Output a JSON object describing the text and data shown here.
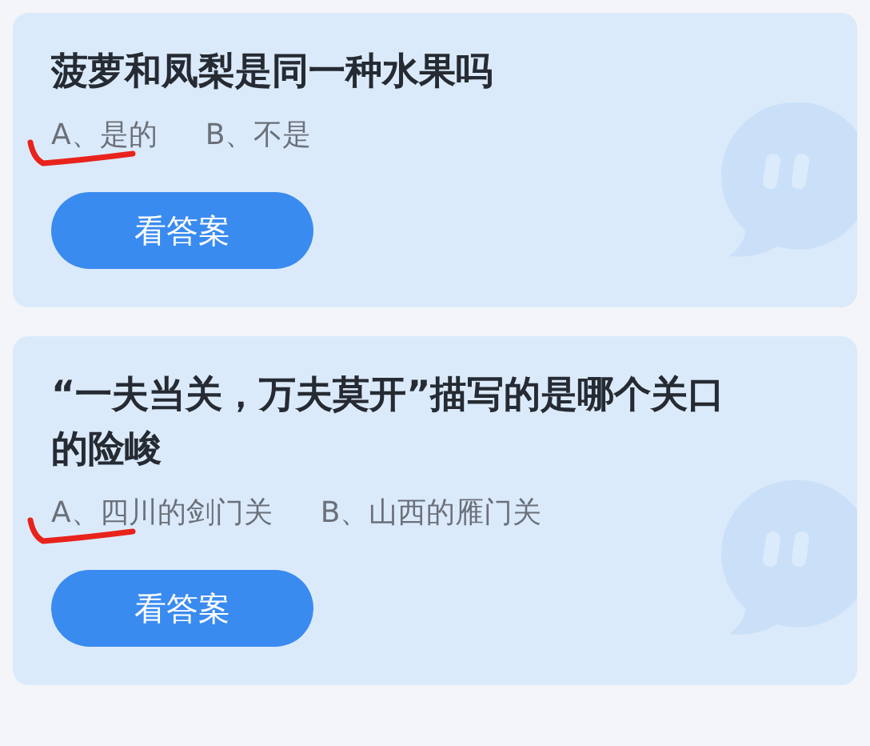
{
  "cards": [
    {
      "question": "菠萝和凤梨是同一种水果吗",
      "options": [
        {
          "text": "A、是的",
          "marked": true
        },
        {
          "text": "B、不是",
          "marked": false
        }
      ],
      "button": "看答案"
    },
    {
      "question": "“一夫当关，万夫莫开”描写的是哪个关口的险峻",
      "options": [
        {
          "text": "A、四川的剑门关",
          "marked": true
        },
        {
          "text": "B、山西的雁门关",
          "marked": false
        }
      ],
      "button": "看答案"
    }
  ]
}
